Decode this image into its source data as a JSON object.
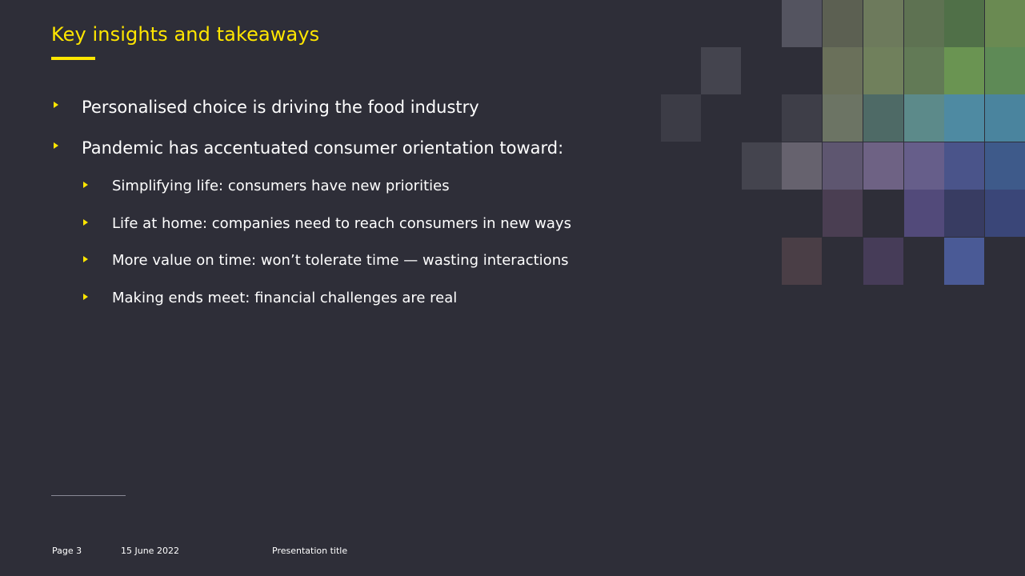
{
  "slide": {
    "title": "Key insights and takeaways",
    "bullets": [
      "Personalised choice is driving the food industry",
      "Pandemic has accentuated consumer orientation toward:"
    ],
    "sub_bullets": [
      "Simplifying life: consumers have new priorities",
      "Life at home: companies need to reach consumers in new ways",
      "More value on time: won’t tolerate time — wasting interactions",
      "Making ends meet: financial challenges are real"
    ]
  },
  "footer": {
    "page": "Page 3",
    "date": "15 June 2022",
    "presentation_title": "Presentation title"
  },
  "colors": {
    "background": "#2e2e38",
    "accent": "#ffe600",
    "text": "#ffffff"
  },
  "icons": {
    "bullet_marker": "triangle-right-icon"
  }
}
